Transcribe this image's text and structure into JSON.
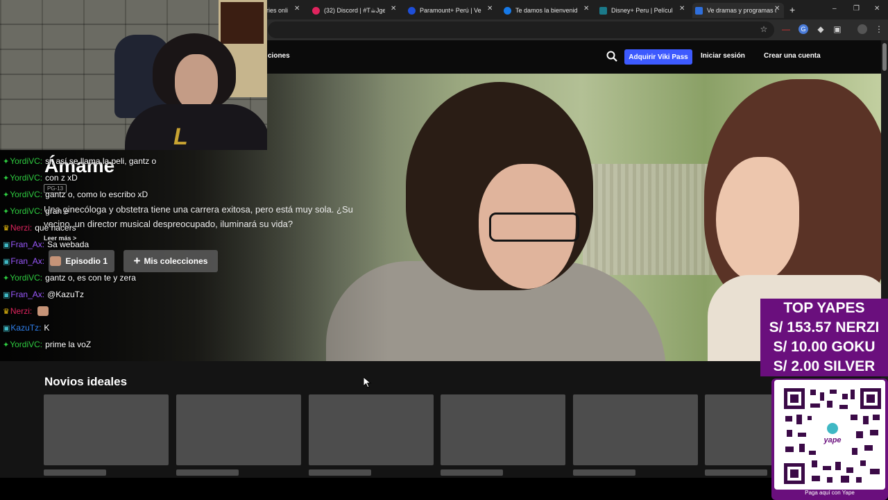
{
  "browser": {
    "tabs": [
      {
        "label": "ries onli",
        "favicon": "generic-favicon"
      },
      {
        "label": "(32) Discord | #T☕Jgene",
        "favicon": "discord-favicon"
      },
      {
        "label": "Paramount+ Perú | Ver pe",
        "favicon": "paramount-favicon"
      },
      {
        "label": "Te damos la bienvenida a",
        "favicon": "disney-favicon"
      },
      {
        "label": "Disney+ Peru | Películas, s",
        "favicon": "disneyplus-favicon"
      },
      {
        "label": "Ve dramas y programas d",
        "favicon": "viki-favicon",
        "active": true
      }
    ],
    "new_tab": "+",
    "close": "✕"
  },
  "viki": {
    "nav_partial": "ciones",
    "vikipass": "Adquirir Viki Pass",
    "login": "Iniciar sesión",
    "signup": "Crear una cuenta",
    "accent": "#3d5afe"
  },
  "hero": {
    "title": "Ámame",
    "rating": "PG-13",
    "synopsis": "Una ginecóloga y obstetra tiene una carrera exitosa, pero está muy sola. ¿Su vecino, un director musical despreocupado, iluminará su vida?",
    "read_more": "Leer más >",
    "episode_button": "Episodio 1",
    "collections_button": "Mis colecciones"
  },
  "row": {
    "title": "Novios ideales"
  },
  "chat": [
    {
      "badge": "✦",
      "badge_color": "#2ecc40",
      "user": "YordiVC:",
      "user_color": "#2ecc40",
      "text": "si, así se llama la peli, gantz o"
    },
    {
      "badge": "✦",
      "badge_color": "#2ecc40",
      "user": "YordiVC:",
      "user_color": "#2ecc40",
      "text": "con z xD"
    },
    {
      "badge": "✦",
      "badge_color": "#2ecc40",
      "user": "YordiVC:",
      "user_color": "#2ecc40",
      "text": "gantz o, como lo escribo xD"
    },
    {
      "badge": "✦",
      "badge_color": "#2ecc40",
      "user": "YordiVC:",
      "user_color": "#2ecc40",
      "text": "gran e"
    },
    {
      "badge": "♛",
      "badge_color": "#f1c40f",
      "user": "Nerzi:",
      "user_color": "#e0245e",
      "text": "que hacers"
    },
    {
      "badge": "▣",
      "badge_color": "#3fb8c4",
      "user": "Fran_Ax:",
      "user_color": "#9b59ff",
      "text": "Sa webada"
    },
    {
      "badge": "▣",
      "badge_color": "#3fb8c4",
      "user": "Fran_Ax:",
      "user_color": "#9b59ff",
      "text": "",
      "emote": true
    },
    {
      "badge": "✦",
      "badge_color": "#2ecc40",
      "user": "YordiVC:",
      "user_color": "#2ecc40",
      "text": "gantz o, es con te y zera"
    },
    {
      "badge": "▣",
      "badge_color": "#3fb8c4",
      "user": "Fran_Ax:",
      "user_color": "#9b59ff",
      "text": "@KazuTz"
    },
    {
      "badge": "♛",
      "badge_color": "#f1c40f",
      "user": "Nerzi:",
      "user_color": "#e0245e",
      "text": "",
      "emote": true
    },
    {
      "badge": "▣",
      "badge_color": "#3fb8c4",
      "user": "KazuTz:",
      "user_color": "#2f80ed",
      "text": "K"
    },
    {
      "badge": "✦",
      "badge_color": "#2ecc40",
      "user": "YordiVC:",
      "user_color": "#2ecc40",
      "text": "prime la voZ"
    }
  ],
  "donations": {
    "heading": "TOP YAPES",
    "entries": [
      "S/ 153.57 NERZI",
      "S/ 10.00 GOKU",
      "S/ 2.00 SILVER"
    ],
    "qr_caption": "Paga aquí con Yape",
    "qr_logo": "yape",
    "color": "#6a0f7d"
  }
}
